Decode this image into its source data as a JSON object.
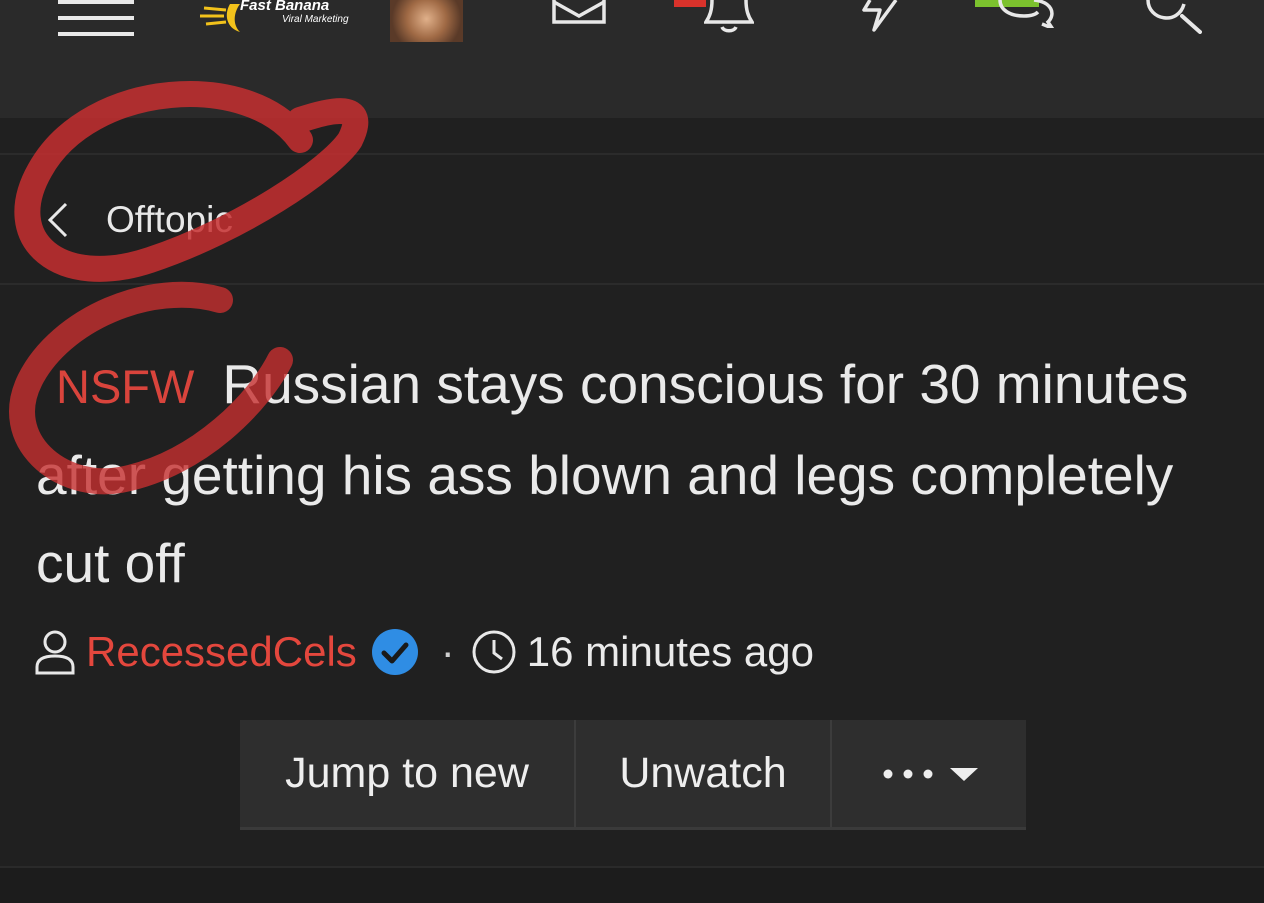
{
  "header": {
    "logo": {
      "brand": "Fast Banana",
      "tagline": "Viral Marketing"
    },
    "icons": [
      "menu-icon",
      "logo",
      "avatar",
      "mail-icon",
      "bell-icon",
      "bolt-icon",
      "chat-icon",
      "search-icon"
    ],
    "badge_colors": {
      "alerts": "#d9322b",
      "conversations": "#7cc22e"
    }
  },
  "breadcrumb": {
    "label": "Offtopic"
  },
  "thread": {
    "prefix": "NSFW",
    "title": "Russian stays conscious for 30 minutes after getting his ass blown and legs completely cut off",
    "author": "RecessedCels",
    "separator": "·",
    "time": "16 minutes ago"
  },
  "actions": {
    "jump_label": "Jump to new",
    "unwatch_label": "Unwatch",
    "more_label": "•••"
  },
  "colors": {
    "background": "#202020",
    "header": "#2a2a2a",
    "accent_red": "#e4473d",
    "verified_blue": "#2f8de4"
  }
}
